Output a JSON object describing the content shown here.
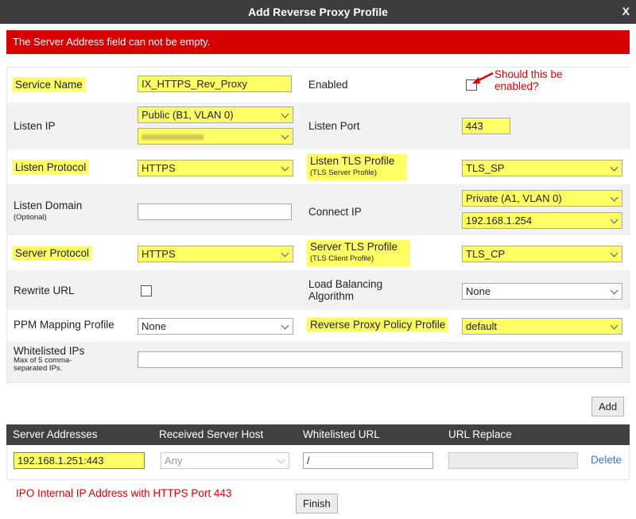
{
  "dialog": {
    "title": "Add Reverse Proxy Profile",
    "close_label": "X"
  },
  "error": {
    "message": "The Server Address field can not be empty."
  },
  "form": {
    "service_name": {
      "label": "Service Name",
      "value": "IX_HTTPS_Rev_Proxy"
    },
    "enabled": {
      "label": "Enabled",
      "checked": false
    },
    "listen_ip": {
      "label": "Listen IP",
      "interface": "Public (B1, VLAN 0)"
    },
    "listen_port": {
      "label": "Listen Port",
      "value": "443"
    },
    "listen_protocol": {
      "label": "Listen Protocol",
      "value": "HTTPS"
    },
    "listen_tls_profile": {
      "label": "Listen TLS Profile",
      "sublabel": "(TLS Server Profile)",
      "value": "TLS_SP"
    },
    "listen_domain": {
      "label": "Listen Domain",
      "sublabel": "(Optional)",
      "value": ""
    },
    "connect_ip": {
      "label": "Connect IP",
      "interface": "Private (A1, VLAN 0)",
      "address": "192.168.1.254"
    },
    "server_protocol": {
      "label": "Server Protocol",
      "value": "HTTPS"
    },
    "server_tls_profile": {
      "label": "Server TLS Profile",
      "sublabel": "(TLS Client Profile)",
      "value": "TLS_CP"
    },
    "rewrite_url": {
      "label": "Rewrite URL",
      "checked": false
    },
    "load_balancing": {
      "label_line1": "Load Balancing",
      "label_line2": "Algorithm",
      "value": "None"
    },
    "ppm_mapping": {
      "label": "PPM Mapping Profile",
      "value": "None"
    },
    "reverse_proxy_policy": {
      "label": "Reverse Proxy Policy Profile",
      "value": "default"
    },
    "whitelisted_ips": {
      "label": "Whitelisted IPs",
      "sublabel_line1": "Max of 5 comma-",
      "sublabel_line2": "separated IPs.",
      "value": ""
    }
  },
  "annotations": {
    "enable_note_line1": "Should this be",
    "enable_note_line2": "enabled?",
    "ipo_note": "IPO Internal IP Address with HTTPS Port 443"
  },
  "buttons": {
    "add": "Add",
    "finish": "Finish"
  },
  "server_table": {
    "headers": [
      "Server Addresses",
      "Received Server Host",
      "Whitelisted URL",
      "URL Replace"
    ],
    "row": {
      "server_address": "192.168.1.251:443",
      "received_server_host": "Any",
      "whitelisted_url": "/",
      "url_replace": "",
      "delete_label": "Delete"
    }
  },
  "colors": {
    "highlight": "#ffff66",
    "error": "#d60000",
    "annotation": "#e00000",
    "link": "#3a7bbf"
  }
}
